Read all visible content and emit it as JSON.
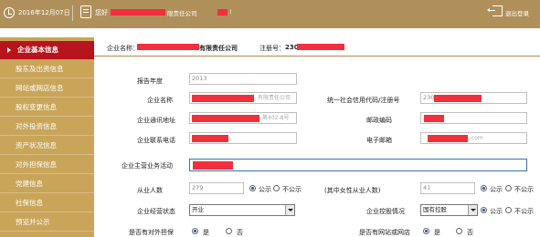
{
  "header": {
    "date": "2016年12月07日",
    "greeting": "您好",
    "company_suffix": "限责任公司",
    "greeting_tail": "!",
    "exit_label": "退出登录"
  },
  "sidebar": {
    "items": [
      {
        "label": "企业基本信息",
        "active": true
      },
      {
        "label": "股东及出资信息"
      },
      {
        "label": "网站或网店信息"
      },
      {
        "label": "股权变更信息"
      },
      {
        "label": "对外投资信息"
      },
      {
        "label": "资产状况信息"
      },
      {
        "label": "对外担保信息"
      },
      {
        "label": "党建信息"
      },
      {
        "label": "社保信息"
      },
      {
        "label": "预览并公示"
      }
    ]
  },
  "company": {
    "name_label": "企业名称：",
    "name_suffix": "有限责任公司",
    "reg_label": "注册号：",
    "reg_prefix": "230"
  },
  "form": {
    "report_year_label": "报告年度",
    "report_year": "2013",
    "name_label": "企业名称",
    "name_tail": "有限责任公司",
    "credit_code_label": "统一社会信用代码/注册号",
    "credit_code_prefix": "230",
    "address_label": "企业通讯地址",
    "address_tail": "第402-8号",
    "postcode_label": "邮政编码",
    "phone_label": "企业联系电话",
    "email_label": "电子邮箱",
    "email_tail": ".com",
    "business_label": "企业主营业务活动",
    "employees_label": "从业人数",
    "employees": "279",
    "female_label": "(其中女性从业人数)",
    "female": "41",
    "public": "公示",
    "not_public": "不公示",
    "status_label": "企业经营状态",
    "status_value": "开业",
    "holding_label": "企业控股情况",
    "holding_value": "国有控股",
    "guarantee_label": "是否有对外担保",
    "website_label": "是否有网站或网店",
    "yes": "是",
    "no": "否"
  }
}
